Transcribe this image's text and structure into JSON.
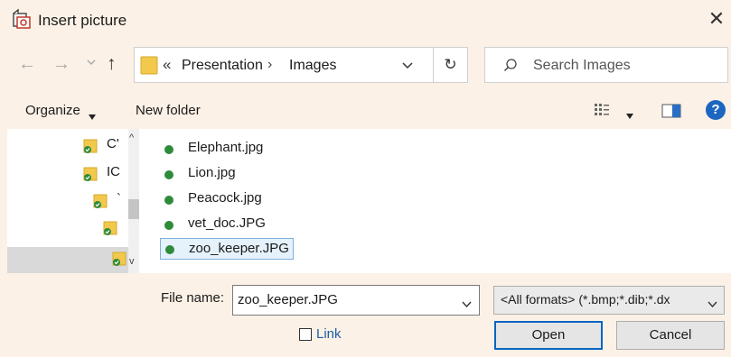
{
  "window": {
    "title": "Insert picture",
    "close_glyph": "✕"
  },
  "nav": {
    "back_glyph": "←",
    "forward_glyph": "→",
    "up_glyph": "↑"
  },
  "address": {
    "guillemet": "«",
    "segments": [
      "Presentation",
      "Images"
    ],
    "separator": "›"
  },
  "refresh_glyph": "↻",
  "search": {
    "placeholder": "Search Images"
  },
  "toolbar": {
    "organize": "Organize",
    "new_folder": "New folder",
    "help": "?"
  },
  "nav_tree": {
    "items": [
      {
        "text": "C' "
      },
      {
        "text": "IC"
      },
      {
        "text": "`"
      },
      {
        "text": ""
      },
      {
        "text": ""
      }
    ],
    "scroll_up_glyph": "^",
    "scroll_down_glyph": "v"
  },
  "files": [
    {
      "name": "Elephant.jpg",
      "selected": false
    },
    {
      "name": "Lion.jpg",
      "selected": false
    },
    {
      "name": "Peacock.jpg",
      "selected": false
    },
    {
      "name": "vet_doc.JPG",
      "selected": false
    },
    {
      "name": "zoo_keeper.JPG",
      "selected": true
    }
  ],
  "bottom": {
    "file_name_label": "File name:",
    "file_name_value": "zoo_keeper.JPG",
    "format": "<All formats> (*.bmp;*.dib;*.dx",
    "link_label": "Link",
    "link_checked": false,
    "open": "Open",
    "cancel": "Cancel"
  },
  "colors": {
    "accent": "#0a64c2",
    "folder": "#f2c94c",
    "sync_badge": "#2e8b3a",
    "background": "#fbf1e6"
  },
  "icons": [
    "insert-picture-icon",
    "back-arrow-icon",
    "forward-arrow-icon",
    "chevron-down-icon",
    "up-arrow-icon",
    "folder-icon",
    "refresh-icon",
    "search-icon",
    "view-menu-icon",
    "preview-pane-icon",
    "help-icon",
    "sync-status-icon"
  ]
}
